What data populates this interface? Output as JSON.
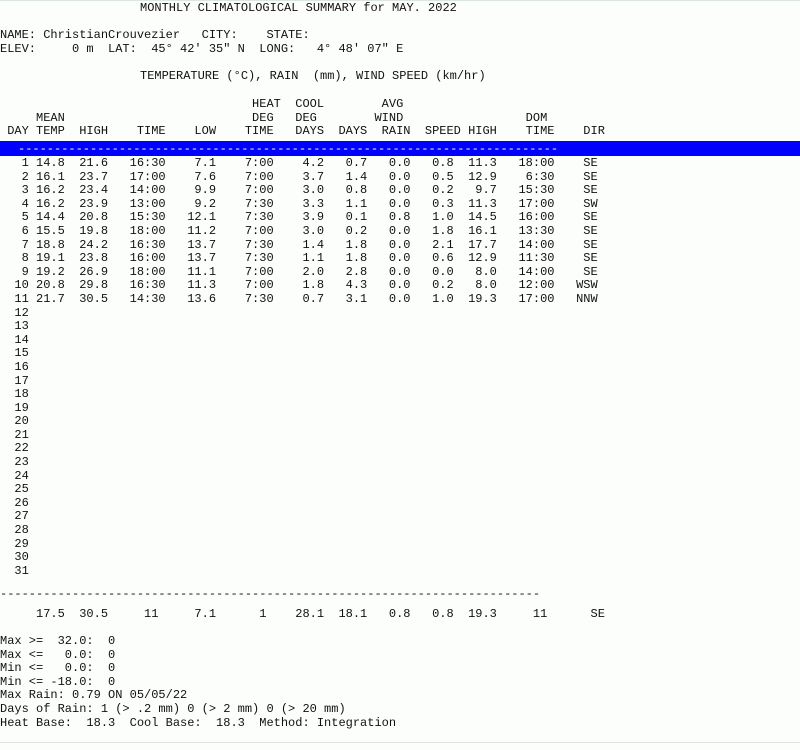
{
  "report": {
    "title": "MONTHLY CLIMATOLOGICAL SUMMARY for MAY. 2022",
    "station": {
      "name_label": "NAME:",
      "name_value": "ChristianCrouvezier",
      "city_label": "CITY:",
      "city_value": "",
      "state_label": "STATE:",
      "state_value": "",
      "elev_label": "ELEV:",
      "elev_value": "0 m",
      "lat_label": "LAT:",
      "lat_value": "45° 42' 35\" N",
      "long_label": "LONG:",
      "long_value": "4° 48' 07\" E",
      "line1": "NAME: ChristianCrouvezier   CITY:    STATE:",
      "line2": "ELEV:     0 m  LAT:  45° 42' 35\" N  LONG:   4° 48' 07\" E"
    },
    "units_line": "TEMPERATURE (°C), RAIN  (mm), WIND SPEED (km/hr)",
    "separator_dashes": "---------------------------------------------------------------------------",
    "selection_color": "#0000ff",
    "selection_text_color": "#ffffff",
    "columns": {
      "row1": "                                   HEAT  COOL        AVG",
      "row2": "     MEAN                          DEG   DEG        WIND                 DOM",
      "row3": " DAY TEMP  HIGH    TIME    LOW    TIME   DAYS  DAYS  RAIN  SPEED HIGH    TIME    DIR",
      "headers": [
        "DAY",
        "MEAN TEMP",
        "HIGH",
        "TIME",
        "LOW",
        "TIME",
        "HEAT DEG DAYS",
        "COOL DEG DAYS",
        "RAIN",
        "AVG WIND SPEED",
        "HIGH",
        "TIME",
        "DOM DIR"
      ]
    },
    "rows": [
      {
        "day": "1",
        "mean_temp": "14.8",
        "high": "21.6",
        "high_time": "16:30",
        "low": "7.1",
        "low_time": "7:00",
        "heat_deg_days": "4.2",
        "cool_deg_days": "0.7",
        "rain": "0.0",
        "avg_wind_speed": "0.8",
        "wind_high": "11.3",
        "wind_time": "18:00",
        "dom_dir": "SE"
      },
      {
        "day": "2",
        "mean_temp": "16.1",
        "high": "23.7",
        "high_time": "17:00",
        "low": "7.6",
        "low_time": "7:00",
        "heat_deg_days": "3.7",
        "cool_deg_days": "1.4",
        "rain": "0.0",
        "avg_wind_speed": "0.5",
        "wind_high": "12.9",
        "wind_time": "6:30",
        "dom_dir": "SE"
      },
      {
        "day": "3",
        "mean_temp": "16.2",
        "high": "23.4",
        "high_time": "14:00",
        "low": "9.9",
        "low_time": "7:00",
        "heat_deg_days": "3.0",
        "cool_deg_days": "0.8",
        "rain": "0.0",
        "avg_wind_speed": "0.2",
        "wind_high": "9.7",
        "wind_time": "15:30",
        "dom_dir": "SE"
      },
      {
        "day": "4",
        "mean_temp": "16.2",
        "high": "23.9",
        "high_time": "13:00",
        "low": "9.2",
        "low_time": "7:30",
        "heat_deg_days": "3.3",
        "cool_deg_days": "1.1",
        "rain": "0.0",
        "avg_wind_speed": "0.3",
        "wind_high": "11.3",
        "wind_time": "17:00",
        "dom_dir": "SW"
      },
      {
        "day": "5",
        "mean_temp": "14.4",
        "high": "20.8",
        "high_time": "15:30",
        "low": "12.1",
        "low_time": "7:30",
        "heat_deg_days": "3.9",
        "cool_deg_days": "0.1",
        "rain": "0.8",
        "avg_wind_speed": "1.0",
        "wind_high": "14.5",
        "wind_time": "16:00",
        "dom_dir": "SE"
      },
      {
        "day": "6",
        "mean_temp": "15.5",
        "high": "19.8",
        "high_time": "18:00",
        "low": "11.2",
        "low_time": "7:00",
        "heat_deg_days": "3.0",
        "cool_deg_days": "0.2",
        "rain": "0.0",
        "avg_wind_speed": "1.8",
        "wind_high": "16.1",
        "wind_time": "13:30",
        "dom_dir": "SE"
      },
      {
        "day": "7",
        "mean_temp": "18.8",
        "high": "24.2",
        "high_time": "16:30",
        "low": "13.7",
        "low_time": "7:30",
        "heat_deg_days": "1.4",
        "cool_deg_days": "1.8",
        "rain": "0.0",
        "avg_wind_speed": "2.1",
        "wind_high": "17.7",
        "wind_time": "14:00",
        "dom_dir": "SE"
      },
      {
        "day": "8",
        "mean_temp": "19.1",
        "high": "23.8",
        "high_time": "16:00",
        "low": "13.7",
        "low_time": "7:30",
        "heat_deg_days": "1.1",
        "cool_deg_days": "1.8",
        "rain": "0.0",
        "avg_wind_speed": "0.6",
        "wind_high": "12.9",
        "wind_time": "11:30",
        "dom_dir": "SE"
      },
      {
        "day": "9",
        "mean_temp": "19.2",
        "high": "26.9",
        "high_time": "18:00",
        "low": "11.1",
        "low_time": "7:00",
        "heat_deg_days": "2.0",
        "cool_deg_days": "2.8",
        "rain": "0.0",
        "avg_wind_speed": "0.0",
        "wind_high": "8.0",
        "wind_time": "14:00",
        "dom_dir": "SE"
      },
      {
        "day": "10",
        "mean_temp": "20.8",
        "high": "29.8",
        "high_time": "16:30",
        "low": "11.3",
        "low_time": "7:00",
        "heat_deg_days": "1.8",
        "cool_deg_days": "4.3",
        "rain": "0.0",
        "avg_wind_speed": "0.2",
        "wind_high": "8.0",
        "wind_time": "12:00",
        "dom_dir": "WSW"
      },
      {
        "day": "11",
        "mean_temp": "21.7",
        "high": "30.5",
        "high_time": "14:30",
        "low": "13.6",
        "low_time": "7:30",
        "heat_deg_days": "0.7",
        "cool_deg_days": "3.1",
        "rain": "0.0",
        "avg_wind_speed": "1.0",
        "wind_high": "19.3",
        "wind_time": "17:00",
        "dom_dir": "NNW"
      },
      {
        "day": "12",
        "mean_temp": "",
        "high": "",
        "high_time": "",
        "low": "",
        "low_time": "",
        "heat_deg_days": "",
        "cool_deg_days": "",
        "rain": "",
        "avg_wind_speed": "",
        "wind_high": "",
        "wind_time": "",
        "dom_dir": ""
      },
      {
        "day": "13",
        "mean_temp": "",
        "high": "",
        "high_time": "",
        "low": "",
        "low_time": "",
        "heat_deg_days": "",
        "cool_deg_days": "",
        "rain": "",
        "avg_wind_speed": "",
        "wind_high": "",
        "wind_time": "",
        "dom_dir": ""
      },
      {
        "day": "14",
        "mean_temp": "",
        "high": "",
        "high_time": "",
        "low": "",
        "low_time": "",
        "heat_deg_days": "",
        "cool_deg_days": "",
        "rain": "",
        "avg_wind_speed": "",
        "wind_high": "",
        "wind_time": "",
        "dom_dir": ""
      },
      {
        "day": "15",
        "mean_temp": "",
        "high": "",
        "high_time": "",
        "low": "",
        "low_time": "",
        "heat_deg_days": "",
        "cool_deg_days": "",
        "rain": "",
        "avg_wind_speed": "",
        "wind_high": "",
        "wind_time": "",
        "dom_dir": ""
      },
      {
        "day": "16",
        "mean_temp": "",
        "high": "",
        "high_time": "",
        "low": "",
        "low_time": "",
        "heat_deg_days": "",
        "cool_deg_days": "",
        "rain": "",
        "avg_wind_speed": "",
        "wind_high": "",
        "wind_time": "",
        "dom_dir": ""
      },
      {
        "day": "17",
        "mean_temp": "",
        "high": "",
        "high_time": "",
        "low": "",
        "low_time": "",
        "heat_deg_days": "",
        "cool_deg_days": "",
        "rain": "",
        "avg_wind_speed": "",
        "wind_high": "",
        "wind_time": "",
        "dom_dir": ""
      },
      {
        "day": "18",
        "mean_temp": "",
        "high": "",
        "high_time": "",
        "low": "",
        "low_time": "",
        "heat_deg_days": "",
        "cool_deg_days": "",
        "rain": "",
        "avg_wind_speed": "",
        "wind_high": "",
        "wind_time": "",
        "dom_dir": ""
      },
      {
        "day": "19",
        "mean_temp": "",
        "high": "",
        "high_time": "",
        "low": "",
        "low_time": "",
        "heat_deg_days": "",
        "cool_deg_days": "",
        "rain": "",
        "avg_wind_speed": "",
        "wind_high": "",
        "wind_time": "",
        "dom_dir": ""
      },
      {
        "day": "20",
        "mean_temp": "",
        "high": "",
        "high_time": "",
        "low": "",
        "low_time": "",
        "heat_deg_days": "",
        "cool_deg_days": "",
        "rain": "",
        "avg_wind_speed": "",
        "wind_high": "",
        "wind_time": "",
        "dom_dir": ""
      },
      {
        "day": "21",
        "mean_temp": "",
        "high": "",
        "high_time": "",
        "low": "",
        "low_time": "",
        "heat_deg_days": "",
        "cool_deg_days": "",
        "rain": "",
        "avg_wind_speed": "",
        "wind_high": "",
        "wind_time": "",
        "dom_dir": ""
      },
      {
        "day": "22",
        "mean_temp": "",
        "high": "",
        "high_time": "",
        "low": "",
        "low_time": "",
        "heat_deg_days": "",
        "cool_deg_days": "",
        "rain": "",
        "avg_wind_speed": "",
        "wind_high": "",
        "wind_time": "",
        "dom_dir": ""
      },
      {
        "day": "23",
        "mean_temp": "",
        "high": "",
        "high_time": "",
        "low": "",
        "low_time": "",
        "heat_deg_days": "",
        "cool_deg_days": "",
        "rain": "",
        "avg_wind_speed": "",
        "wind_high": "",
        "wind_time": "",
        "dom_dir": ""
      },
      {
        "day": "24",
        "mean_temp": "",
        "high": "",
        "high_time": "",
        "low": "",
        "low_time": "",
        "heat_deg_days": "",
        "cool_deg_days": "",
        "rain": "",
        "avg_wind_speed": "",
        "wind_high": "",
        "wind_time": "",
        "dom_dir": ""
      },
      {
        "day": "25",
        "mean_temp": "",
        "high": "",
        "high_time": "",
        "low": "",
        "low_time": "",
        "heat_deg_days": "",
        "cool_deg_days": "",
        "rain": "",
        "avg_wind_speed": "",
        "wind_high": "",
        "wind_time": "",
        "dom_dir": ""
      },
      {
        "day": "26",
        "mean_temp": "",
        "high": "",
        "high_time": "",
        "low": "",
        "low_time": "",
        "heat_deg_days": "",
        "cool_deg_days": "",
        "rain": "",
        "avg_wind_speed": "",
        "wind_high": "",
        "wind_time": "",
        "dom_dir": ""
      },
      {
        "day": "27",
        "mean_temp": "",
        "high": "",
        "high_time": "",
        "low": "",
        "low_time": "",
        "heat_deg_days": "",
        "cool_deg_days": "",
        "rain": "",
        "avg_wind_speed": "",
        "wind_high": "",
        "wind_time": "",
        "dom_dir": ""
      },
      {
        "day": "28",
        "mean_temp": "",
        "high": "",
        "high_time": "",
        "low": "",
        "low_time": "",
        "heat_deg_days": "",
        "cool_deg_days": "",
        "rain": "",
        "avg_wind_speed": "",
        "wind_high": "",
        "wind_time": "",
        "dom_dir": ""
      },
      {
        "day": "29",
        "mean_temp": "",
        "high": "",
        "high_time": "",
        "low": "",
        "low_time": "",
        "heat_deg_days": "",
        "cool_deg_days": "",
        "rain": "",
        "avg_wind_speed": "",
        "wind_high": "",
        "wind_time": "",
        "dom_dir": ""
      },
      {
        "day": "30",
        "mean_temp": "",
        "high": "",
        "high_time": "",
        "low": "",
        "low_time": "",
        "heat_deg_days": "",
        "cool_deg_days": "",
        "rain": "",
        "avg_wind_speed": "",
        "wind_high": "",
        "wind_time": "",
        "dom_dir": ""
      },
      {
        "day": "31",
        "mean_temp": "",
        "high": "",
        "high_time": "",
        "low": "",
        "low_time": "",
        "heat_deg_days": "",
        "cool_deg_days": "",
        "rain": "",
        "avg_wind_speed": "",
        "wind_high": "",
        "wind_time": "",
        "dom_dir": ""
      }
    ],
    "totals": {
      "mean_temp": "17.5",
      "high": "30.5",
      "high_time": "11",
      "low": "7.1",
      "low_time": "1",
      "heat_deg_days": "28.1",
      "cool_deg_days": "18.1",
      "rain": "0.8",
      "avg_wind_speed": "0.8",
      "wind_high": "19.3",
      "wind_time": "11",
      "dom_dir": "SE",
      "line": "     17.5  30.5     11     7.1      1    28.1  18.1   0.8   0.8  19.3     11      SE"
    },
    "stats": {
      "max_ge_label": "Max >=  32.0:",
      "max_ge_value": "0",
      "max_le_label": "Max <=   0.0:",
      "max_le_value": "0",
      "min_le_label": "Min <=   0.0:",
      "min_le_value": "0",
      "min_le_neg_label": "Min <= -18.0:",
      "min_le_neg_value": "0",
      "max_rain_line": "Max Rain: 0.79 ON 05/05/22",
      "days_of_rain_line": "Days of Rain: 1 (> .2 mm) 0 (> 2 mm) 0 (> 20 mm)",
      "bases_line": "Heat Base:  18.3  Cool Base:  18.3  Method: Integration",
      "line1": "Max >=  32.0:  0",
      "line2": "Max <=   0.0:  0",
      "line3": "Min <=   0.0:  0",
      "line4": "Min <= -18.0:  0"
    }
  }
}
